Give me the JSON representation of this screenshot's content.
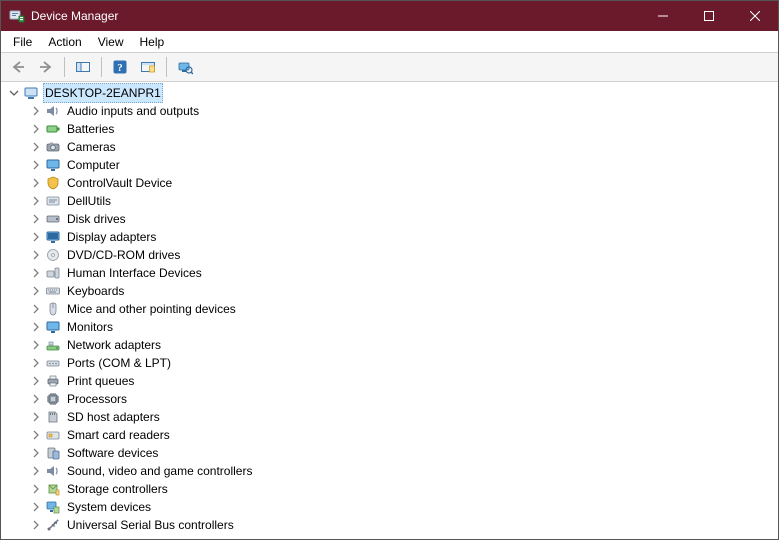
{
  "window": {
    "title": "Device Manager"
  },
  "menu": {
    "file": "File",
    "action": "Action",
    "view": "View",
    "help": "Help"
  },
  "tree": {
    "root": {
      "label": "DESKTOP-2EANPR1",
      "icon": "computer"
    },
    "items": [
      {
        "label": "Audio inputs and outputs",
        "icon": "audio"
      },
      {
        "label": "Batteries",
        "icon": "battery"
      },
      {
        "label": "Cameras",
        "icon": "camera"
      },
      {
        "label": "Computer",
        "icon": "monitor"
      },
      {
        "label": "ControlVault Device",
        "icon": "shield"
      },
      {
        "label": "DellUtils",
        "icon": "dell"
      },
      {
        "label": "Disk drives",
        "icon": "disk"
      },
      {
        "label": "Display adapters",
        "icon": "display"
      },
      {
        "label": "DVD/CD-ROM drives",
        "icon": "cd"
      },
      {
        "label": "Human Interface Devices",
        "icon": "hid"
      },
      {
        "label": "Keyboards",
        "icon": "keyboard"
      },
      {
        "label": "Mice and other pointing devices",
        "icon": "mouse"
      },
      {
        "label": "Monitors",
        "icon": "monitor"
      },
      {
        "label": "Network adapters",
        "icon": "network"
      },
      {
        "label": "Ports (COM & LPT)",
        "icon": "port"
      },
      {
        "label": "Print queues",
        "icon": "printer"
      },
      {
        "label": "Processors",
        "icon": "cpu"
      },
      {
        "label": "SD host adapters",
        "icon": "sd"
      },
      {
        "label": "Smart card readers",
        "icon": "smartcard"
      },
      {
        "label": "Software devices",
        "icon": "software"
      },
      {
        "label": "Sound, video and game controllers",
        "icon": "audio"
      },
      {
        "label": "Storage controllers",
        "icon": "storage"
      },
      {
        "label": "System devices",
        "icon": "system"
      },
      {
        "label": "Universal Serial Bus controllers",
        "icon": "usb"
      }
    ]
  }
}
